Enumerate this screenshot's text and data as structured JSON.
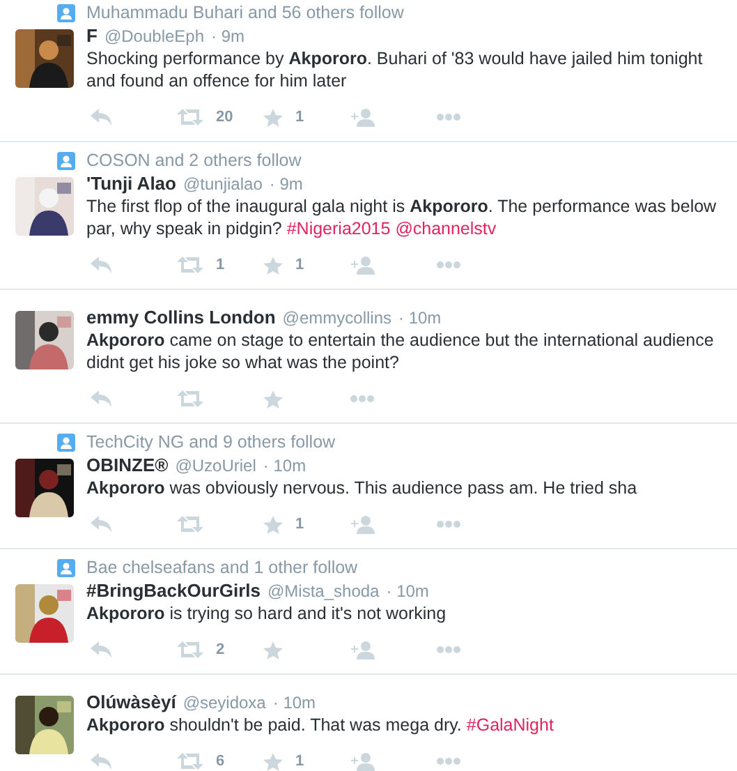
{
  "tweets": [
    {
      "context": "Muhammadu Buhari and 56 others follow",
      "name": "F",
      "handle": "@DoubleEph",
      "time": "· 9m",
      "avatar": {
        "kind": "picture"
      },
      "body": [
        {
          "kind": "text",
          "text": "Shocking performance by **Akpororo**. Buhari of '83 would have jailed him tonight and found an offence for him later"
        }
      ],
      "actions": [
        {
          "kind": "reply"
        },
        {
          "kind": "retweet",
          "count": "20"
        },
        {
          "kind": "favorite",
          "count": "1"
        },
        {
          "kind": "follow"
        },
        {
          "kind": "more"
        }
      ]
    },
    {
      "context": "COSON and 2 others follow",
      "name": "'Tunji Alao",
      "handle": "@tunjialao",
      "time": "· 9m",
      "avatar": {
        "kind": "picture"
      },
      "body": [
        {
          "kind": "text",
          "text": "The first flop of the inaugural gala night is **Akpororo**. The performance was below par, why speak in pidgin? "
        },
        {
          "kind": "link",
          "text": "#Nigeria2015"
        },
        {
          "kind": "link",
          "text": "@channelstv"
        }
      ],
      "actions": [
        {
          "kind": "reply"
        },
        {
          "kind": "retweet",
          "count": "1"
        },
        {
          "kind": "favorite",
          "count": "1"
        },
        {
          "kind": "follow"
        },
        {
          "kind": "more"
        }
      ]
    },
    {
      "name": "emmy Collins London",
      "handle": "@emmycollins",
      "time": "· 10m",
      "avatar": {
        "kind": "picture"
      },
      "body": [
        {
          "kind": "text",
          "text": "**Akpororo** came on stage to entertain the audience but the international audience didnt get his joke so what was the point?"
        }
      ],
      "actions": [
        {
          "kind": "reply"
        },
        {
          "kind": "retweet"
        },
        {
          "kind": "favorite"
        },
        {
          "kind": "more"
        }
      ]
    },
    {
      "context": "TechCity NG and 9 others follow",
      "name": "OBINZE®",
      "handle": "@UzoUriel",
      "time": "· 10m",
      "avatar": {
        "kind": "picture"
      },
      "body": [
        {
          "kind": "text",
          "text": "**Akpororo** was obviously nervous. This audience pass am. He tried sha"
        }
      ],
      "actions": [
        {
          "kind": "reply"
        },
        {
          "kind": "retweet"
        },
        {
          "kind": "favorite",
          "count": "1"
        },
        {
          "kind": "follow"
        },
        {
          "kind": "more"
        }
      ]
    },
    {
      "context": "Bae chelseafans and 1 other follow",
      "name": "#BringBackOurGirls",
      "handle": "@Mista_shoda",
      "time": "· 10m",
      "avatar": {
        "kind": "picture"
      },
      "body": [
        {
          "kind": "text",
          "text": "**Akpororo** is trying so hard and it's not working"
        }
      ],
      "actions": [
        {
          "kind": "reply"
        },
        {
          "kind": "retweet",
          "count": "2"
        },
        {
          "kind": "favorite"
        },
        {
          "kind": "follow"
        },
        {
          "kind": "more"
        }
      ]
    },
    {
      "name": "Olúwàsèyí",
      "handle": "@seyidoxa",
      "time": "· 10m",
      "avatar": {
        "kind": "picture"
      },
      "body": [
        {
          "kind": "text",
          "text": "**Akpororo** shouldn't be paid. That was mega dry. "
        },
        {
          "kind": "link",
          "text": "#GalaNight"
        }
      ],
      "actions": [
        {
          "kind": "reply"
        },
        {
          "kind": "retweet",
          "count": "6"
        },
        {
          "kind": "favorite",
          "count": "1"
        },
        {
          "kind": "follow"
        },
        {
          "kind": "more"
        }
      ]
    }
  ]
}
